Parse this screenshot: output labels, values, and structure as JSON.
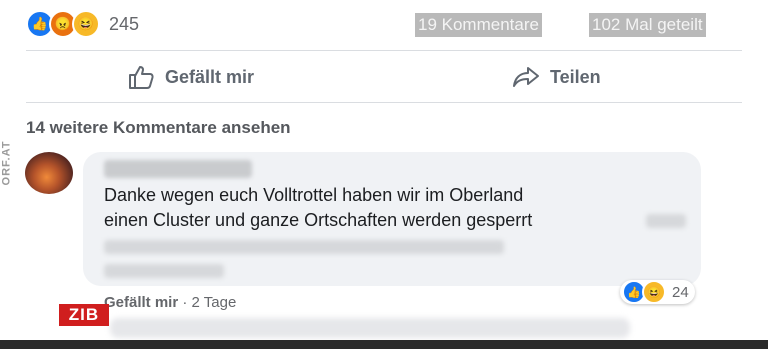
{
  "reactions": {
    "icons": [
      "like-icon",
      "angry-icon",
      "haha-icon"
    ],
    "count": "245"
  },
  "stats": {
    "comments": "19 Kommentare",
    "shares": "102 Mal geteilt"
  },
  "actions": {
    "like": "Gefällt mir",
    "share": "Teilen"
  },
  "more_comments": "14 weitere Kommentare ansehen",
  "comment": {
    "line1": "Danke wegen euch Volltrottel haben wir im Oberland",
    "line2": "einen Cluster und ganze Ortschaften werden gesperrt",
    "like_label": "Gefällt mir",
    "time": "2 Tage",
    "reaction_count": "24"
  },
  "overlay": {
    "zib": "ZIB",
    "orf": "ORF.AT"
  },
  "colors": {
    "accent": "#1877f2",
    "zib_red": "#d01e1e"
  }
}
